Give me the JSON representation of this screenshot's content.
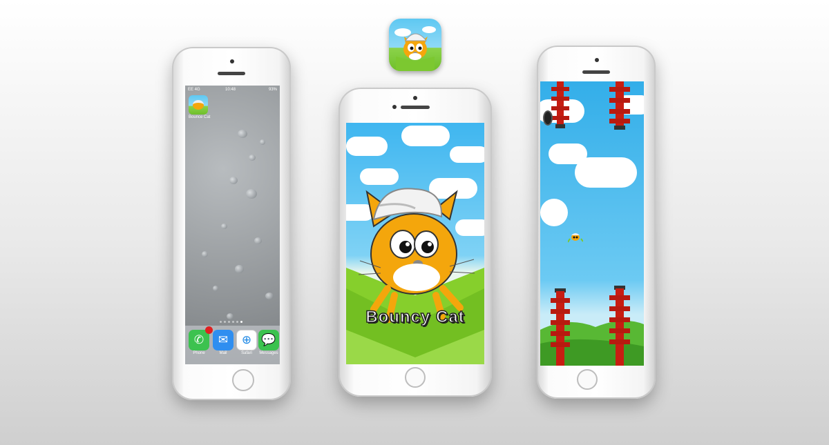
{
  "app_icon": {
    "name": "bouncy-cat-app-icon"
  },
  "left_phone": {
    "status": {
      "carrier": "EE 4G",
      "time": "10:48",
      "battery": "93%"
    },
    "home_app": {
      "label": "Bounce Cat"
    },
    "dock": [
      {
        "label": "Phone",
        "icon": "phone-icon",
        "color": "#3cc24f",
        "badge": true
      },
      {
        "label": "Mail",
        "icon": "mail-icon",
        "color": "#2f8ef0",
        "badge": false
      },
      {
        "label": "Safari",
        "icon": "safari-icon",
        "color": "#1e88e5",
        "badge": false
      },
      {
        "label": "Messages",
        "icon": "messages-icon",
        "color": "#3cc24f",
        "badge": false
      }
    ]
  },
  "center_phone": {
    "splash": {
      "title": "Bouncy Cat"
    },
    "colors": {
      "sky": "#4cc4f2",
      "grass": "#86cf2c",
      "cat": "#f4a60c"
    }
  },
  "right_phone": {
    "colors": {
      "sky": "#3fb8ef",
      "pipe": "#c71d12",
      "grass": "#58b834"
    }
  }
}
